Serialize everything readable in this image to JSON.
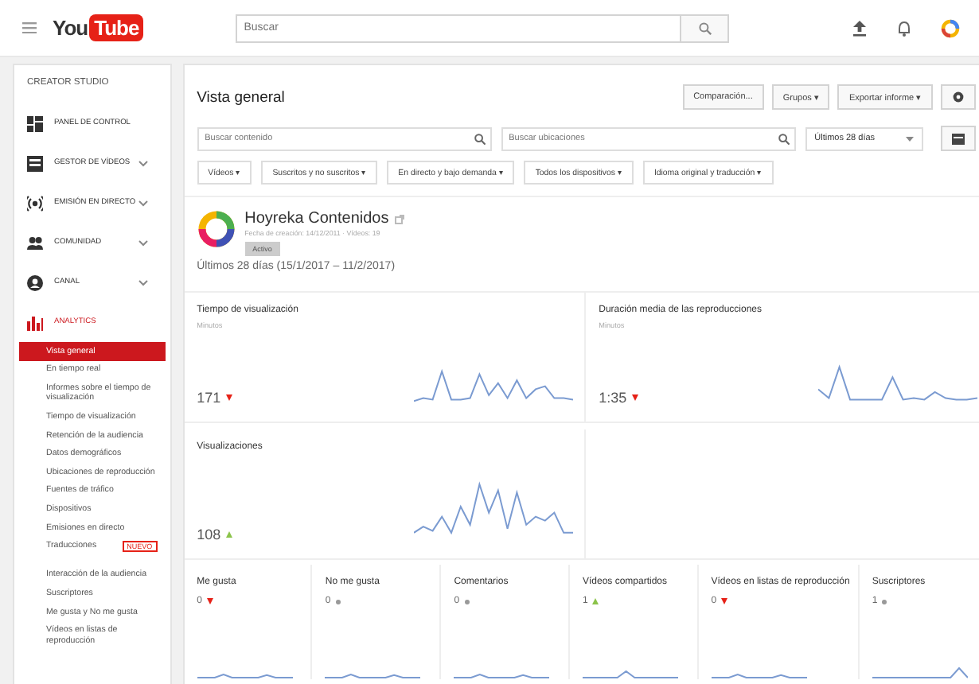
{
  "topbar": {
    "logo_left": "You",
    "logo_right": "Tube",
    "search": {
      "placeholder": "Buscar"
    }
  },
  "sidebar": {
    "title": "CREATOR STUDIO",
    "sections": [
      {
        "label": "PANEL DE CONTROL",
        "kind": "link",
        "selected": false
      },
      {
        "label": "GESTOR DE VÍDEOS",
        "kind": "menu",
        "selected": false
      },
      {
        "label": "EMISIÓN EN DIRECTO",
        "kind": "menu",
        "selected": false
      },
      {
        "label": "COMUNIDAD",
        "kind": "menu",
        "selected": false
      },
      {
        "label": "CANAL",
        "kind": "menu",
        "selected": false
      },
      {
        "label": "ANALYTICS",
        "kind": "link",
        "selected": true
      }
    ],
    "analytics_items": [
      {
        "label": "Vista general",
        "selected": true
      },
      {
        "label": "En tiempo real",
        "selected": false
      },
      {
        "label": "Informes sobre el tiempo de visualización",
        "selected": false
      },
      {
        "label": "Tiempo de visualización",
        "selected": false
      },
      {
        "label": "Retención de la audiencia",
        "selected": false
      },
      {
        "label": "Datos demográficos",
        "selected": false
      },
      {
        "label": "Ubicaciones de reproducción",
        "selected": false
      },
      {
        "label": "Fuentes de tráfico",
        "selected": false
      },
      {
        "label": "Dispositivos",
        "selected": false
      },
      {
        "label": "Emisiones en directo",
        "selected": false
      },
      {
        "label": "Traducciones",
        "selected": false,
        "badge": "NUEVO"
      },
      {
        "label": "Interacción de la audiencia",
        "selected": false,
        "group_start": true
      },
      {
        "label": "Suscriptores",
        "selected": false
      },
      {
        "label": "Me gusta y No me gusta",
        "selected": false
      },
      {
        "label": "Vídeos en listas de reproducción",
        "selected": false
      }
    ]
  },
  "main": {
    "title": "Vista general",
    "buttons": [
      "Comparación...",
      "Grupos ▾",
      "Exportar informe ▾"
    ],
    "search_content": {
      "placeholder": "Buscar contenido"
    },
    "search_locations": {
      "placeholder": "Buscar ubicaciones"
    },
    "date_range": "Últimos 28 días",
    "filters": [
      "Vídeos ▾",
      "Suscritos y no suscritos ▾",
      "En directo y bajo demanda ▾",
      "Todos los dispositivos ▾",
      "Idioma original y traducción ▾"
    ],
    "channel": {
      "name": "Hoyreka Contenidos",
      "meta": "Fecha de creación: 14/12/2011 · Vídeos: 19",
      "tag": "Activo",
      "period": "Últimos 28 días (15/1/2017 – 11/2/2017)"
    },
    "metrics": [
      {
        "title": "Tiempo de visualización",
        "unit": "Minutos",
        "value": "171",
        "kind": "down"
      },
      {
        "title": "Duración media de las reproducciones",
        "unit": "Minutos",
        "value": "1:35",
        "kind": "down"
      },
      {
        "title": "Visualizaciones",
        "value": "108",
        "kind": "up"
      }
    ],
    "small_metrics": [
      {
        "title": "Me gusta",
        "value": "0",
        "kind": "down"
      },
      {
        "title": "No me gusta",
        "value": "0",
        "kind": "flat"
      },
      {
        "title": "Comentarios",
        "value": "0",
        "kind": "flat"
      },
      {
        "title": "Vídeos compartidos",
        "value": "1",
        "kind": "up"
      },
      {
        "title": "Vídeos en listas de reproducción",
        "value": "0",
        "kind": "down"
      },
      {
        "title": "Suscriptores",
        "value": "1",
        "kind": "flat"
      }
    ]
  }
}
